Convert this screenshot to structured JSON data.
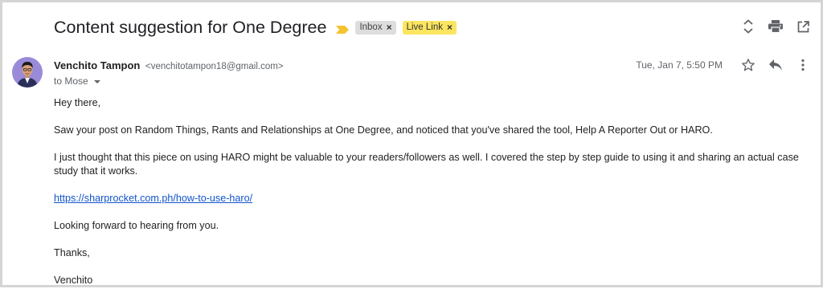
{
  "email": {
    "subject": "Content suggestion for One Degree",
    "labels": [
      {
        "text": "Inbox",
        "close": "×"
      },
      {
        "text": "Live Link",
        "close": "×"
      }
    ],
    "sender_name": "Venchito Tampon",
    "sender_email": "<venchitotampon18@gmail.com>",
    "to_text": "to Mose",
    "date": "Tue, Jan 7, 5:50 PM",
    "body": {
      "greeting": "Hey there,",
      "paragraph1": "Saw your post on Random Things, Rants and Relationships at One Degree, and noticed that you've shared the tool, Help A Reporter Out or HARO.",
      "paragraph2": "I just thought that this piece on using HARO might be valuable to your readers/followers as well. I covered the step by step guide to using it and sharing an actual case study that it works.",
      "link": "https://sharprocket.com.ph/how-to-use-haro/",
      "paragraph3": "Looking forward to hearing from you.",
      "thanks": "Thanks,",
      "signature": "Venchito"
    }
  },
  "icons": {
    "importance": "importance-marker-icon",
    "expand": "expand-collapse-icon",
    "print": "print-icon",
    "new_window": "open-in-new-window-icon",
    "star": "star-icon",
    "reply": "reply-icon",
    "more": "more-vert-icon"
  },
  "colors": {
    "importance_marker": "#f4c430",
    "inbox_label_bg": "#dddddd",
    "live_link_label_bg": "#fce55f",
    "link": "#1155cc"
  }
}
